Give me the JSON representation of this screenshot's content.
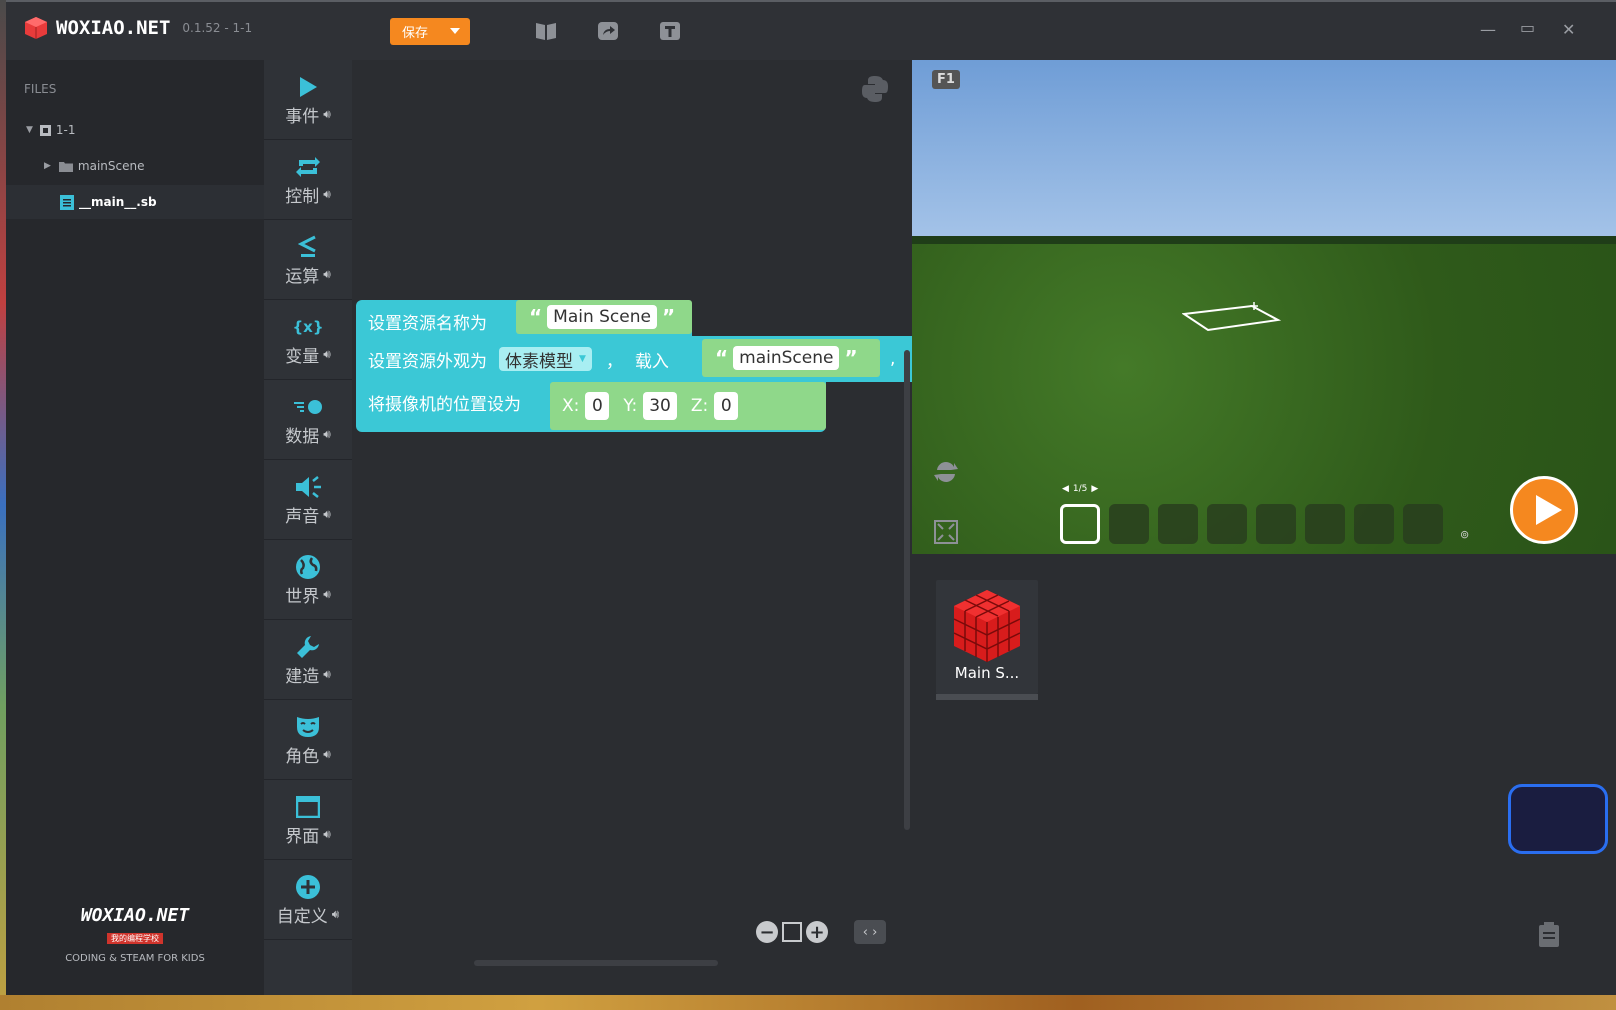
{
  "app": {
    "title": "WOXIAO.NET",
    "version": "0.1.52 - 1-1"
  },
  "toolbar": {
    "save_label": "保存",
    "icons": [
      "book-icon",
      "share-icon",
      "text-icon"
    ]
  },
  "files": {
    "label": "FILES",
    "tree": [
      {
        "label": "1-1"
      },
      {
        "label": "mainScene"
      },
      {
        "label": "__main__.sb"
      }
    ]
  },
  "footer": {
    "logo": "WOXIAO.NET",
    "subtitle": "我的编程学校",
    "tagline": "CODING & STEAM FOR KIDS"
  },
  "categories": [
    {
      "label": "事件",
      "icon": "play-icon"
    },
    {
      "label": "控制",
      "icon": "repeat-icon"
    },
    {
      "label": "运算",
      "icon": "less-equal-icon"
    },
    {
      "label": "变量",
      "icon": "variable-icon"
    },
    {
      "label": "数据",
      "icon": "data-icon"
    },
    {
      "label": "声音",
      "icon": "speaker-icon"
    },
    {
      "label": "世界",
      "icon": "globe-icon"
    },
    {
      "label": "建造",
      "icon": "wrench-icon"
    },
    {
      "label": "角色",
      "icon": "mask-icon"
    },
    {
      "label": "界面",
      "icon": "window-icon"
    },
    {
      "label": "自定义",
      "icon": "plus-circle-icon"
    }
  ],
  "blocks": {
    "b1": {
      "text": "设置资源名称为",
      "value": "Main Scene"
    },
    "b2": {
      "text": "设置资源外观为",
      "dropdown": "体素模型",
      "comma": "，",
      "text2": "载入",
      "value": "mainScene",
      "comma2": ","
    },
    "b3": {
      "text": "将摄像机的位置设为",
      "x_label": "X:",
      "x": "0",
      "y_label": "Y:",
      "y": "30",
      "z_label": "Z:",
      "z": "0"
    }
  },
  "viewport": {
    "f1": "F1",
    "page": "1/5"
  },
  "assets": [
    {
      "label": "Main S..."
    }
  ],
  "colors": {
    "accent": "#f5881f",
    "block": "#3bc8d6",
    "slot": "#8fd88a"
  }
}
